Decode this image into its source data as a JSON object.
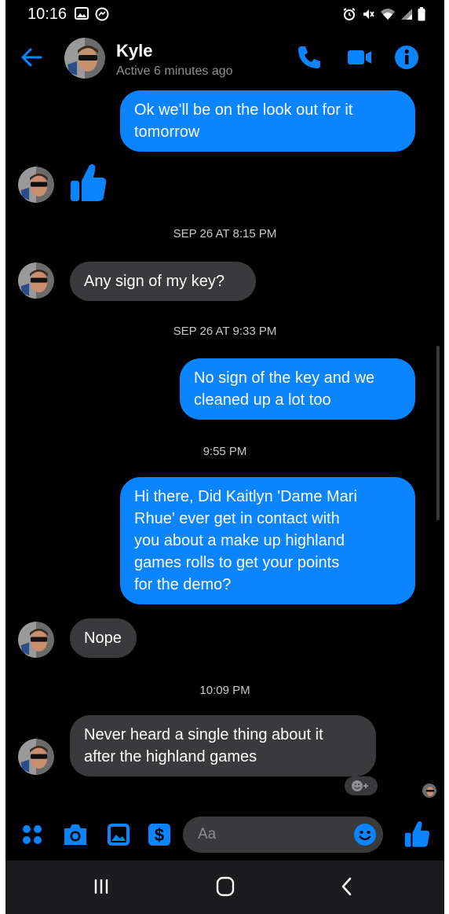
{
  "status_bar": {
    "time": "10:16",
    "left_icons": [
      "gallery-icon",
      "messenger-icon"
    ],
    "right_icons": [
      "alarm-icon",
      "mute-icon",
      "wifi-icon",
      "signal-icon",
      "battery-icon"
    ]
  },
  "header": {
    "name": "Kyle",
    "status": "Active 6 minutes ago",
    "actions": [
      "phone-icon",
      "video-icon",
      "info-icon"
    ]
  },
  "colors": {
    "accent": "#0a84ff",
    "incoming_bubble": "#3a3a3c",
    "background": "#000000"
  },
  "thread": {
    "msg1": "Ok we'll be on the look out for it\ntomorrow",
    "msg2_reaction": "thumbs-up-icon",
    "ts1": "SEP 26 AT 8:15 PM",
    "msg3": "Any sign of my key?",
    "ts2": "SEP 26 AT 9:33 PM",
    "msg4": "No sign of the key and we\ncleaned up a lot too",
    "ts3": "9:55 PM",
    "msg5": "Hi there, Did Kaitlyn 'Dame Mari\nRhue' ever get in contact with\nyou about a make up highland\ngames rolls to get your points\nfor the demo?",
    "msg6": "Nope",
    "ts4": "10:09 PM",
    "msg7": "Never heard a single thing about it\nafter the highland games"
  },
  "composer": {
    "placeholder": "Aa",
    "buttons": [
      "menu-dots-icon",
      "camera-icon",
      "image-icon",
      "payment-icon",
      "emoji-icon",
      "like-icon"
    ]
  },
  "nav_bar": {
    "buttons": [
      "recents-icon",
      "home-icon",
      "back-icon"
    ]
  }
}
